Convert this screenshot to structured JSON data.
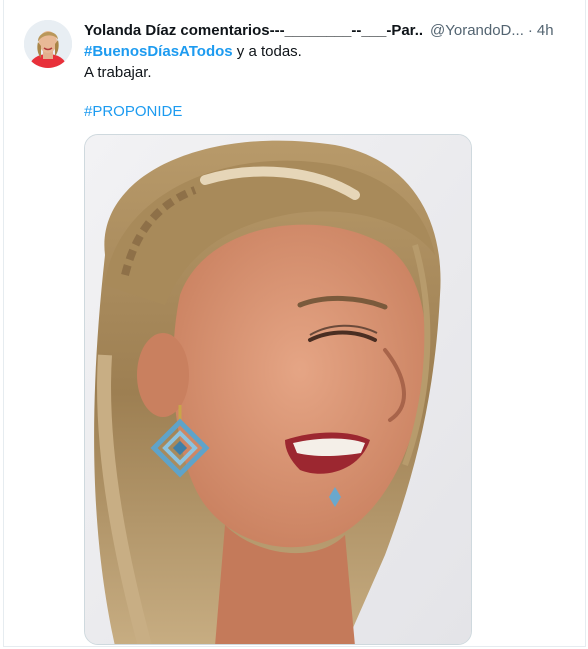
{
  "tweet": {
    "display_name": "Yolanda Díaz comentarios---________--___-Par...",
    "handle": "@YorandoD...",
    "separator": "·",
    "time": "4h",
    "hashtag_main": "#BuenosDíasATodos",
    "text_after_hashtag": " y a todas.",
    "line2": "A trabajar.",
    "hashtag_secondary": "#PROPONIDE",
    "avatar_icon": "profile-photo",
    "media_icon": "photo-woman-laughing"
  },
  "colors": {
    "link": "#1d9bf0",
    "secondary_text": "#536471",
    "border": "#cfd9de"
  }
}
